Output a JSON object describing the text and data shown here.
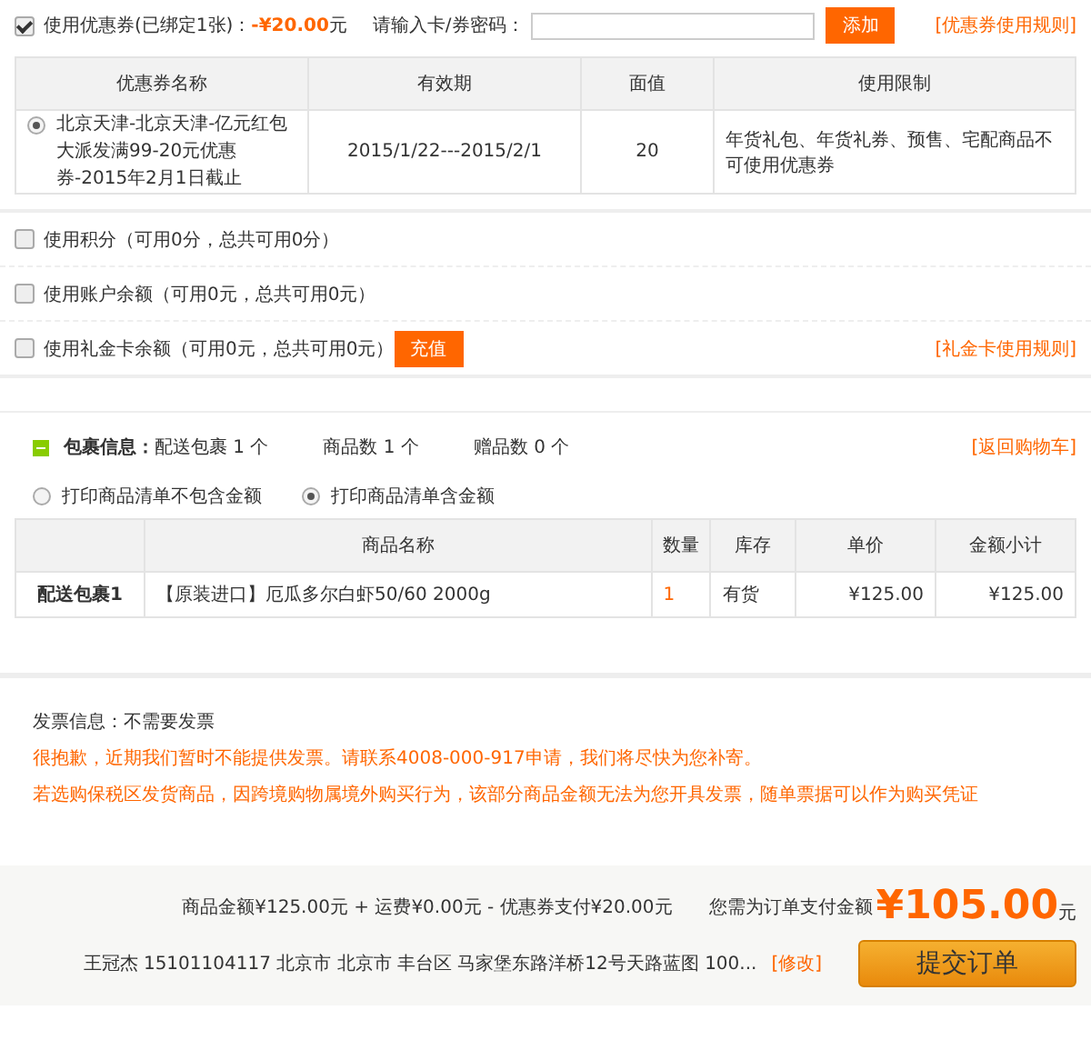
{
  "coupon": {
    "checked": true,
    "label": "使用优惠券(已绑定1张)：",
    "amount": "-¥20.00",
    "unit": "元",
    "code_label": "请输入卡/券密码：",
    "add_button": "添加",
    "rules_link": "[优惠券使用规则]"
  },
  "coupon_table": {
    "columns": [
      "优惠券名称",
      "有效期",
      "面值",
      "使用限制"
    ],
    "rows": [
      {
        "selected": true,
        "cells": [
          "北京天津-北京天津-亿元红包大派发满99-20元优惠券-2015年2月1日截止",
          "2015/1/22---2015/2/1",
          "20",
          "年货礼包、年货礼券、预售、宅配商品不可使用优惠券"
        ]
      }
    ]
  },
  "options": [
    {
      "kind": "plain",
      "checked": false,
      "label": "使用积分（可用0分，总共可用0分）"
    },
    {
      "kind": "plain",
      "checked": false,
      "label": "使用账户余额（可用0元，总共可用0元）"
    },
    {
      "kind": "recharge",
      "checked": false,
      "label": "使用礼金卡余额（可用0元，总共可用0元）",
      "button": "充值",
      "link": "[礼金卡使用规则]"
    }
  ],
  "package": {
    "expanded": true,
    "title": "包裹信息：",
    "parcels": "配送包裹 1 个",
    "items": "商品数 1 个",
    "gifts": "赠品数 0 个",
    "back_link": "[返回购物车]"
  },
  "print_options": [
    {
      "label": "打印商品清单不包含金额",
      "selected": false
    },
    {
      "label": "打印商品清单含金额",
      "selected": true
    }
  ],
  "items_table": {
    "columns": [
      "商品名称",
      "数量",
      "库存",
      "单价",
      "金额小计"
    ],
    "rows": [
      {
        "package": "配送包裹1",
        "name": "【原装进口】厄瓜多尔白虾50/60 2000g",
        "quantity": "1",
        "stock": "有货",
        "price": "¥125.00",
        "subtotal": "¥125.00"
      }
    ]
  },
  "invoice": {
    "label": "发票信息：不需要发票",
    "notices": [
      "很抱歉，近期我们暂时不能提供发票。请联系4008-000-917申请，我们将尽快为您补寄。",
      "若选购保税区发货商品，因跨境购物属境外购买行为，该部分商品金额无法为您开具发票，随单票据可以作为购买凭证"
    ]
  },
  "summary": {
    "breakdown": "商品金额¥125.00元 + 运费¥0.00元 - 优惠券支付¥20.00元",
    "pay_label": "您需为订单支付金额",
    "total": "¥105.00",
    "unit": "元",
    "address": "王冠杰 15101104117 北京市 北京市 丰台区 马家堡东路洋桥12号天路蓝图 100...",
    "edit_link": "[修改]",
    "submit": "提交订单"
  }
}
